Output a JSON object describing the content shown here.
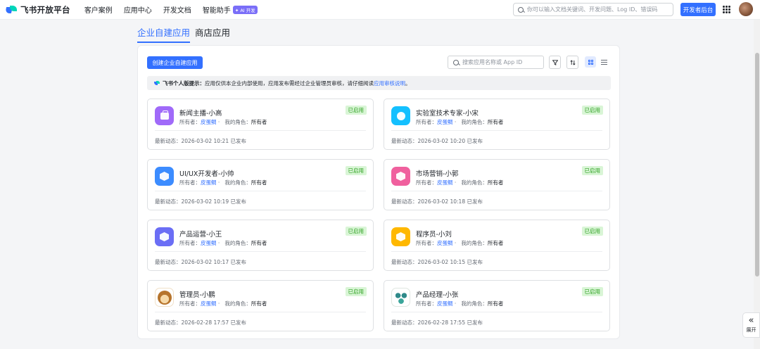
{
  "header": {
    "brand": "飞书开放平台",
    "nav": [
      "客户案例",
      "应用中心",
      "开发文档",
      "智能助手"
    ],
    "ai_badge": "✦ AI 开发",
    "search_placeholder": "你可以输入文档关键词、开发问题、Log ID、错误码",
    "console_button": "开发者后台"
  },
  "tabs": {
    "enterprise": "企业自建应用",
    "store": "商店应用"
  },
  "toolbar": {
    "create_button": "创建企业自建应用",
    "search_placeholder": "搜索应用名称或 App ID"
  },
  "notice": {
    "title": "飞书个人版提示：",
    "text": "应用仅供本企业内部使用，应用发布需经过企业管理员审核，请仔细阅读",
    "link": "应用审核说明",
    "end": "。"
  },
  "labels": {
    "owner_prefix": "所有者：",
    "role_prefix": "我的角色：",
    "activity_prefix": "最新动态："
  },
  "apps": [
    {
      "name": "新闻主播-小高",
      "owner": "皮蛋鲷",
      "role": "所有者",
      "status": "已启用",
      "activity": "2026-03-02 10:21 已发布",
      "icon": "briefcase-icon",
      "color": "#a06af9"
    },
    {
      "name": "实验室技术专家-小宋",
      "owner": "皮蛋鲷",
      "role": "所有者",
      "status": "已启用",
      "activity": "2026-03-02 10:20 已发布",
      "icon": "lightbulb-icon",
      "color": "#14c0ff"
    },
    {
      "name": "UI/UX开发者-小帅",
      "owner": "皮蛋鲷",
      "role": "所有者",
      "status": "已启用",
      "activity": "2026-03-02 10:19 已发布",
      "icon": "cube-icon",
      "color": "#3c8cff"
    },
    {
      "name": "市场营销-小郭",
      "owner": "皮蛋鲷",
      "role": "所有者",
      "status": "已启用",
      "activity": "2026-03-02 10:18 已发布",
      "icon": "cube-icon",
      "color": "#f0609e"
    },
    {
      "name": "产品运营-小王",
      "owner": "皮蛋鲷",
      "role": "所有者",
      "status": "已启用",
      "activity": "2026-03-02 10:17 已发布",
      "icon": "cube-icon",
      "color": "#6b6ef5"
    },
    {
      "name": "程序员-小刘",
      "owner": "皮蛋鲷",
      "role": "所有者",
      "status": "已启用",
      "activity": "2026-03-02 10:15 已发布",
      "icon": "cube-icon",
      "color": "#ffb800"
    },
    {
      "name": "管理员-小鹏",
      "owner": "皮蛋鲷",
      "role": "所有者",
      "status": "已启用",
      "activity": "2026-02-28 17:57 已发布",
      "icon": "monkey-avatar-icon",
      "color": "#b6742c"
    },
    {
      "name": "产品经理-小张",
      "owner": "皮蛋鲷",
      "role": "所有者",
      "status": "已启用",
      "activity": "2026-02-28 17:55 已发布",
      "icon": "team-avatar-icon",
      "color": "#2f8a8a"
    }
  ],
  "expand_label": "展开"
}
